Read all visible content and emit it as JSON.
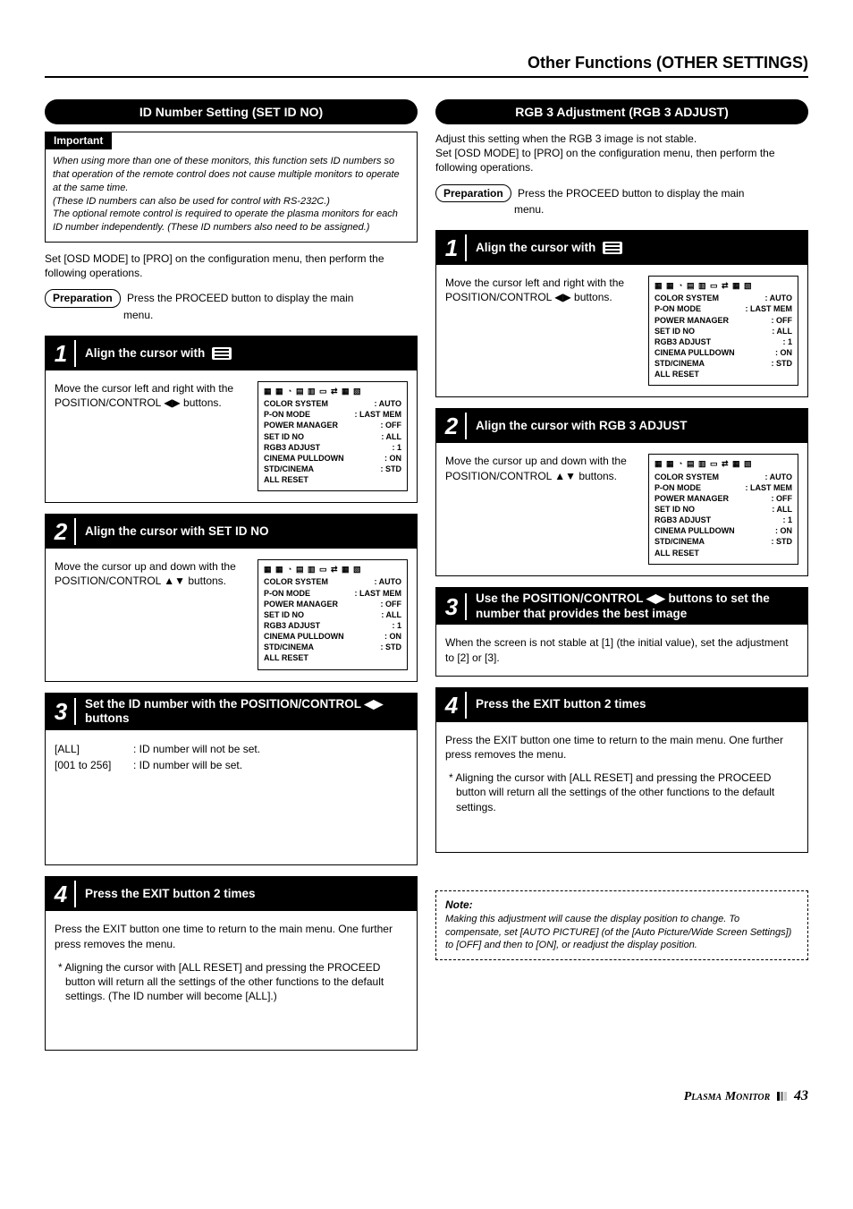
{
  "page": {
    "title": "Other Functions (OTHER SETTINGS)",
    "footer_label": "Plasma Monitor",
    "footer_page": "43"
  },
  "left": {
    "section_title": "ID Number Setting (SET ID NO)",
    "important_label": "Important",
    "important_p1": "When using more than one of these monitors, this function sets ID numbers so that operation of the remote control does not cause multiple monitors to operate at the same time.",
    "important_p2": "(These ID numbers can also be used for control with RS-232C.)",
    "important_p3": "The optional remote control is required to operate the plasma monitors for each ID number independently. (These ID numbers also need to be assigned.)",
    "intro": "Set [OSD MODE] to [PRO] on the configuration menu, then perform the following operations.",
    "prep_label": "Preparation",
    "prep_text_a": "Press the PROCEED button to display the main",
    "prep_text_b": "menu.",
    "step1": {
      "title": "Align the cursor with",
      "body": "Move the cursor left and right with the POSITION/CONTROL ◀▶ buttons."
    },
    "step2": {
      "title": "Align the cursor with SET ID NO",
      "body": "Move the cursor up and down with the POSITION/CONTROL ▲▼ buttons."
    },
    "step3": {
      "title": "Set the ID number with the POSITION/CONTROL ◀▶ buttons",
      "def_all_k": "[ALL]",
      "def_all_v": ": ID number will not be set.",
      "def_range_k": "[001 to 256]",
      "def_range_v": ": ID number will be set."
    },
    "step4": {
      "title": "Press the EXIT button 2 times",
      "body": "Press the EXIT button one time to return to the main menu. One further press removes the menu.",
      "foot": "* Aligning the cursor with [ALL RESET] and pressing the PROCEED button will return all the settings of the other functions to the default settings. (The ID number will become [ALL].)"
    }
  },
  "right": {
    "section_title": "RGB 3 Adjustment (RGB 3 ADJUST)",
    "intro1": "Adjust this setting when the RGB 3 image is not stable.",
    "intro2": "Set [OSD MODE] to [PRO] on the configuration menu, then perform the following operations.",
    "prep_label": "Preparation",
    "prep_text_a": "Press the PROCEED button to display the main",
    "prep_text_b": "menu.",
    "step1": {
      "title": "Align the cursor with",
      "body": "Move the cursor left and right with the POSITION/CONTROL ◀▶ buttons."
    },
    "step2": {
      "title": "Align the cursor with RGB 3 ADJUST",
      "body": "Move the cursor up and down with the POSITION/CONTROL ▲▼ buttons."
    },
    "step3": {
      "title": "Use the POSITION/CONTROL ◀▶ buttons to set the number that provides the best image",
      "body": "When the screen is not stable at [1] (the initial value), set the adjustment to [2] or [3]."
    },
    "step4": {
      "title": "Press the EXIT button 2 times",
      "body": "Press the EXIT button one time to return to the main menu. One further press removes the menu.",
      "foot": "* Aligning the cursor with [ALL RESET] and pressing the PROCEED button will return all the settings of the other functions to the default settings."
    },
    "note_label": "Note:",
    "note_body": "Making this adjustment will cause the display position to change. To compensate, set [AUTO PICTURE] (of the [Auto Picture/Wide Screen Settings]) to [OFF] and then to [ON], or readjust the display position."
  },
  "osd": {
    "icons": "▦ ▦ ◔ ▤ ▥ ▭ ⇄ ▦ ▧",
    "rows": [
      {
        "k": "COLOR SYSTEM",
        "v": ": AUTO"
      },
      {
        "k": "P-ON MODE",
        "v": ": LAST MEM"
      },
      {
        "k": "POWER MANAGER",
        "v": ": OFF"
      },
      {
        "k": "SET ID NO",
        "v": ": ALL"
      },
      {
        "k": "RGB3 ADJUST",
        "v": ": 1"
      },
      {
        "k": "CINEMA PULLDOWN",
        "v": ": ON"
      },
      {
        "k": "STD/CINEMA",
        "v": ": STD"
      },
      {
        "k": "ALL RESET",
        "v": ""
      }
    ]
  }
}
